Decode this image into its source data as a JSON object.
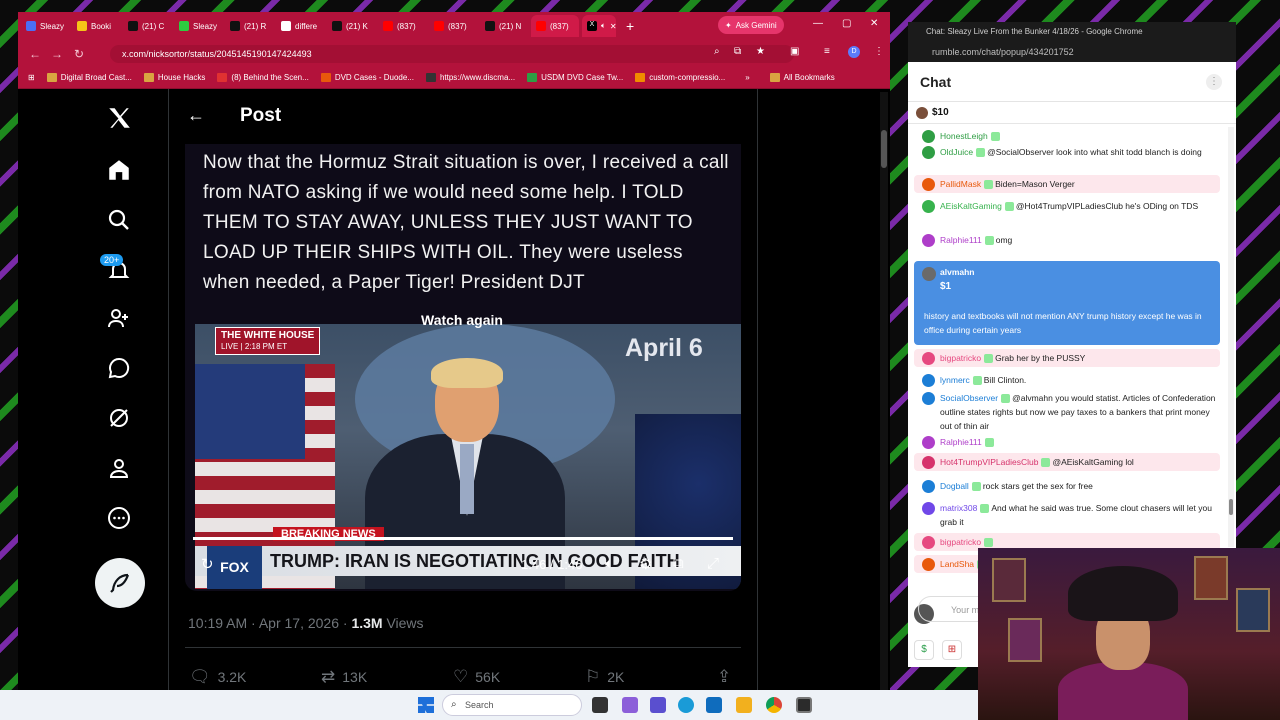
{
  "browser": {
    "tabs": [
      {
        "label": "Sleazy",
        "color": "#4c6ef5"
      },
      {
        "label": "Booki",
        "color": "#f5c518"
      },
      {
        "label": "(21) C",
        "color": "#111111"
      },
      {
        "label": "Sleazy",
        "color": "#2ecc40"
      },
      {
        "label": "(21) R",
        "color": "#111111"
      },
      {
        "label": "differe",
        "color": "#ffffff"
      },
      {
        "label": "(21) K",
        "color": "#111111"
      },
      {
        "label": "(837)",
        "color": "#ff0000"
      },
      {
        "label": "(837)",
        "color": "#ff0000"
      },
      {
        "label": "(21) N",
        "color": "#111111"
      },
      {
        "label": "(837)",
        "color": "#ff0000"
      }
    ],
    "new_tab": "+",
    "ask_gemini": "Ask Gemini",
    "url": "x.com/nicksortor/status/2045145190147424493",
    "bookmarks": [
      "Digital Broad Cast...",
      "House Hacks",
      "(8) Behind the Scen...",
      "DVD Cases - Duode...",
      "https://www.discma...",
      "USDM DVD Case Tw...",
      "custom-compressio..."
    ],
    "all_bookmarks": "All Bookmarks"
  },
  "x": {
    "notif_count": "20+",
    "post_title": "Post",
    "caption": "Now that the Hormuz Strait situation is over, I received a call from NATO asking if we would need some help. I TOLD THEM TO STAY AWAY, UNLESS THEY JUST WANT TO LOAD UP THEIR SHIPS WITH OIL. They were useless when needed, a Paper Tiger! President DJT",
    "watch_again": "Watch again",
    "wh_logo": "THE WHITE HOUSE",
    "wh_live": "LIVE | 2:18 PM ET",
    "april": "April 6",
    "breaking": "BREAKING NEWS",
    "lower_third": "TRUMP: IRAN IS NEGOTIATING IN GOOD FAITH",
    "fox": "FOX",
    "timecode": "1:46 / 1:46",
    "post_time": "10:19 AM · Apr 17, 2026 · ",
    "views_num": "1.3M",
    "views_label": " Views",
    "replies": "3.2K",
    "reposts": "13K",
    "likes": "56K",
    "bookmarks": "2K"
  },
  "chat": {
    "window_title": "Chat: Sleazy Live From the Bunker 4/18/26 - Google Chrome",
    "url": "rumble.com/chat/popup/434201752",
    "header": "Chat",
    "tip_amount": "$10",
    "messages": [
      {
        "user": "HonestLeigh",
        "text": "",
        "color": "#2f9e44"
      },
      {
        "user": "OldJuice",
        "text": "@SocialObserver look into what shit todd blanch is doing",
        "color": "#2f9e44"
      },
      {
        "user": "PallidMask",
        "text": "Biden=Mason Verger",
        "color": "#e8590c"
      },
      {
        "user": "AEisKaltGaming",
        "text": "@Hot4TrumpVIPLadiesClub he's ODing on TDS",
        "color": "#37b24d"
      },
      {
        "user": "Ralphie111",
        "text": "omg",
        "color": "#ae3ec9"
      },
      {
        "user": "bigpatricko",
        "text": "Grab her by the PUSSY",
        "color": "#e64980"
      },
      {
        "user": "lynmerc",
        "text": "Bill Clinton.",
        "color": "#1c7ed6"
      },
      {
        "user": "SocialObserver",
        "text": "@alvmahn you would statist. Articles of Confederation outline states rights but now we pay taxes to a bankers that print money out of thin air",
        "color": "#1c7ed6"
      },
      {
        "user": "Ralphie111",
        "text": "",
        "color": "#ae3ec9"
      },
      {
        "user": "Hot4TrumpVIPLadiesClub",
        "text": "@AEisKaltGaming lol",
        "color": "#d6336c"
      },
      {
        "user": "Dogball",
        "text": "rock stars get the sex for free",
        "color": "#1c7ed6"
      },
      {
        "user": "matrix308",
        "text": "And what he said was true. Some clout chasers will let you grab it",
        "color": "#7048e8"
      },
      {
        "user": "bigpatricko",
        "text": "",
        "color": "#e64980"
      },
      {
        "user": "LandSha",
        "text": "",
        "color": "#e8590c"
      }
    ],
    "paid": {
      "user": "alvmahn",
      "amount": "$1",
      "text": "history and textbooks will not mention ANY trump history except he was in office during certain years"
    },
    "input_placeholder": "Your m"
  },
  "taskbar": {
    "search": "Search"
  }
}
